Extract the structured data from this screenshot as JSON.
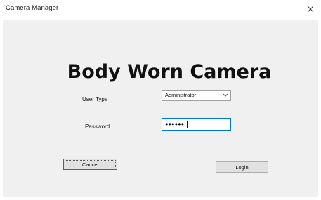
{
  "window": {
    "title": "Camera Manager",
    "close_icon": "close-icon"
  },
  "form": {
    "heading": "Body Worn Camera",
    "user_type": {
      "label": "User Type :",
      "value": "Administrator"
    },
    "password": {
      "label": "Password :",
      "value": "●●●●●●"
    }
  },
  "buttons": {
    "cancel_label": "Cancel",
    "login_label": "Login"
  },
  "colors": {
    "client_background": "#f0f0f0",
    "focus_border": "#0078d7",
    "button_face": "#e1e1e1"
  }
}
